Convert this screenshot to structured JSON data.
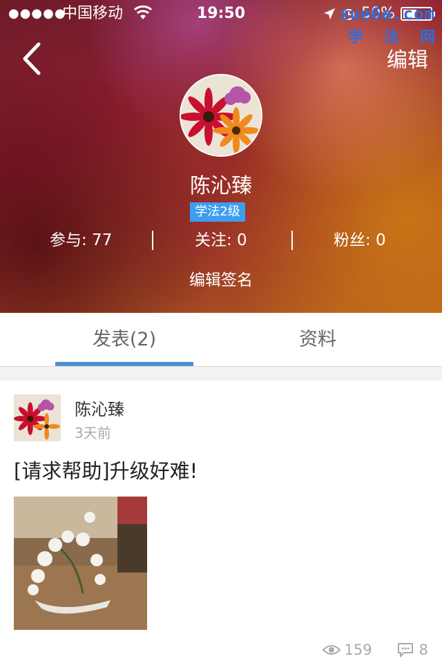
{
  "status_bar": {
    "signal": "●●●●●",
    "carrier": "中国移动",
    "time": "19:50",
    "battery": "50%",
    "battery_level": 0.5
  },
  "watermark": {
    "url": "xue6a.com",
    "chars": "学法网"
  },
  "header": {
    "edit_label": "编辑",
    "user_name": "陈沁臻",
    "level": "学法2级",
    "stats": {
      "participate": "参与: 77",
      "follow": "关注: 0",
      "fans": "粉丝: 0"
    },
    "edit_signature": "编辑签名"
  },
  "tabs": [
    {
      "label": "发表(2)",
      "active": true
    },
    {
      "label": "资料",
      "active": false
    }
  ],
  "post": {
    "author": "陈沁臻",
    "time": "3天前",
    "title": "[请求帮助]升级好难!",
    "views": "159",
    "comments": "8"
  },
  "colors": {
    "accent": "#4c8fd3",
    "badge": "#3d9ef0",
    "watermark": "#2b6fe0"
  },
  "icons": [
    "back-icon",
    "wifi-icon",
    "location-icon",
    "alarm-icon",
    "battery-icon",
    "eye-icon",
    "comment-icon"
  ]
}
